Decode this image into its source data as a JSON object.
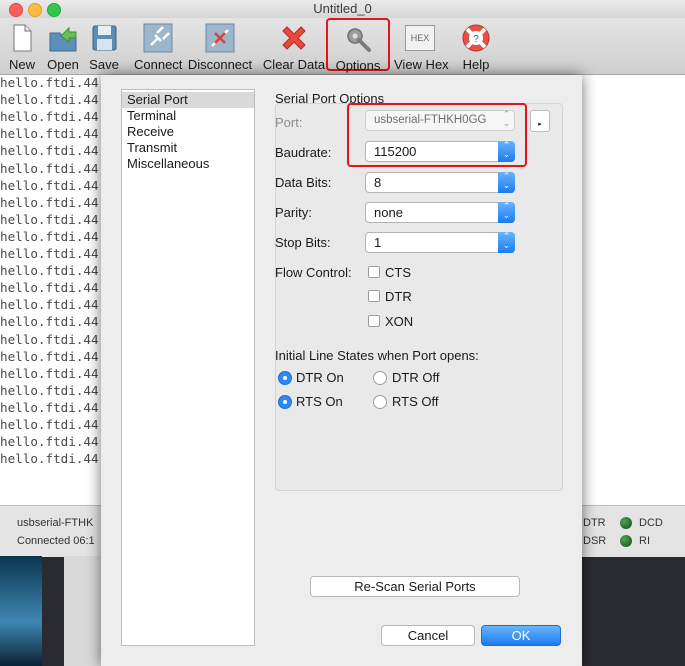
{
  "window": {
    "title": "Untitled_0"
  },
  "toolbar": {
    "items": [
      {
        "label": "New",
        "icon": "new-document-icon"
      },
      {
        "label": "Open",
        "icon": "open-folder-icon"
      },
      {
        "label": "Save",
        "icon": "save-disk-icon"
      },
      {
        "label": "Connect",
        "icon": "connect-plug-icon"
      },
      {
        "label": "Disconnect",
        "icon": "disconnect-plug-icon"
      },
      {
        "label": "Clear Data",
        "icon": "clear-x-icon"
      },
      {
        "label": "Options",
        "icon": "options-gear-icon"
      },
      {
        "label": "View Hex",
        "icon": "hex-icon",
        "icon_text": "HEX"
      },
      {
        "label": "Help",
        "icon": "help-lifebuoy-icon"
      }
    ]
  },
  "terminal": {
    "lines": [
      "hello.ftdi.44",
      "hello.ftdi.44",
      "hello.ftdi.44",
      "hello.ftdi.44",
      "hello.ftdi.44",
      "hello.ftdi.44",
      "hello.ftdi.44",
      "hello.ftdi.44",
      "hello.ftdi.44",
      "hello.ftdi.44",
      "hello.ftdi.44",
      "hello.ftdi.44",
      "hello.ftdi.44",
      "hello.ftdi.44",
      "hello.ftdi.44",
      "hello.ftdi.44",
      "hello.ftdi.44",
      "hello.ftdi.44",
      "hello.ftdi.44",
      "hello.ftdi.44",
      "hello.ftdi.44",
      "hello.ftdi.44",
      "hello.ftdi.44"
    ]
  },
  "status": {
    "port": "usbserial-FTHK",
    "connected": "Connected 06:1",
    "signals": {
      "dtr": "DTR",
      "dsr": "DSR",
      "dcd": "DCD",
      "ri": "RI"
    }
  },
  "dialog": {
    "sidebar": [
      "Serial Port",
      "Terminal",
      "Receive",
      "Transmit",
      "Miscellaneous"
    ],
    "section_title": "Serial Port Options",
    "port": {
      "label": "Port:",
      "value": "usbserial-FTHKH0GG"
    },
    "baudrate": {
      "label": "Baudrate:",
      "value": "115200"
    },
    "data_bits": {
      "label": "Data Bits:",
      "value": "8"
    },
    "parity": {
      "label": "Parity:",
      "value": "none"
    },
    "stop_bits": {
      "label": "Stop Bits:",
      "value": "1"
    },
    "flow_control": {
      "label": "Flow Control:",
      "options": [
        {
          "label": "CTS",
          "checked": false
        },
        {
          "label": "DTR",
          "checked": false
        },
        {
          "label": "XON",
          "checked": false
        }
      ]
    },
    "line_states": {
      "title": "Initial Line States when Port opens:",
      "dtr_on": "DTR On",
      "dtr_off": "DTR Off",
      "rts_on": "RTS On",
      "rts_off": "RTS Off",
      "dtr_selected": "on",
      "rts_selected": "on"
    },
    "rescan_label": "Re-Scan Serial Ports",
    "cancel_label": "Cancel",
    "ok_label": "OK"
  },
  "colors": {
    "accent": "#1b7cf1",
    "highlight": "#e4141b",
    "led": "#2f8a36"
  }
}
